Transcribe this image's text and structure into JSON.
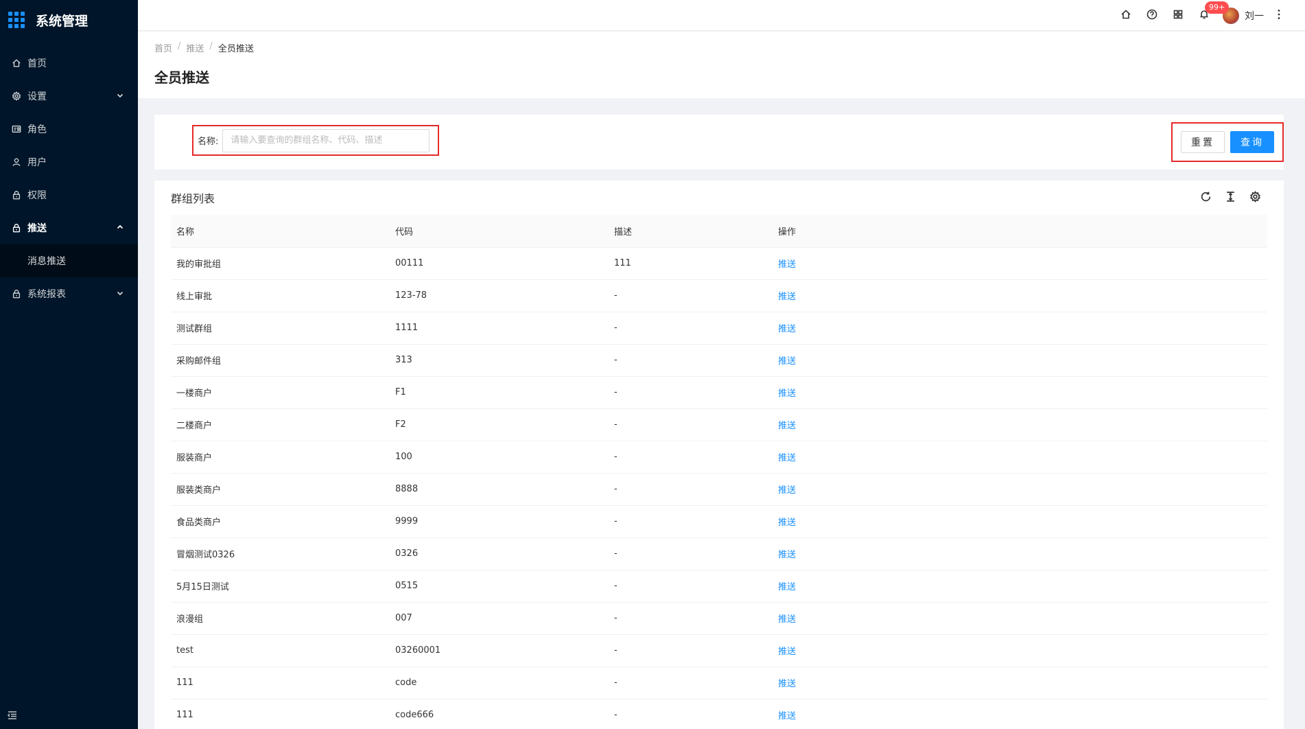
{
  "app": {
    "title": "系统管理"
  },
  "sidebar": {
    "items": [
      {
        "label": "首页",
        "icon": "home-icon"
      },
      {
        "label": "设置",
        "icon": "gear-icon",
        "expandable": true
      },
      {
        "label": "角色",
        "icon": "id-card-icon"
      },
      {
        "label": "用户",
        "icon": "user-icon"
      },
      {
        "label": "权限",
        "icon": "lock-icon"
      },
      {
        "label": "推送",
        "icon": "lock-icon",
        "expandable": true,
        "open": true
      },
      {
        "label": "系统报表",
        "icon": "lock-icon",
        "expandable": true
      }
    ],
    "submenu_push": [
      {
        "label": "消息推送"
      }
    ]
  },
  "header": {
    "notification_count": "99+",
    "username": "刘一"
  },
  "breadcrumb": {
    "home": "首页",
    "parent": "推送",
    "current": "全员推送"
  },
  "page": {
    "title": "全员推送"
  },
  "search": {
    "label": "名称:",
    "placeholder": "请输入要查询的群组名称、代码、描述",
    "value": "",
    "reset_label": "重置",
    "query_label": "查询"
  },
  "table": {
    "title": "群组列表",
    "columns": [
      "名称",
      "代码",
      "描述",
      "操作"
    ],
    "action_label": "推送",
    "rows": [
      {
        "name": "我的审批组",
        "code": "00111",
        "desc": "111"
      },
      {
        "name": "线上审批",
        "code": "123-78",
        "desc": "-"
      },
      {
        "name": "测试群组",
        "code": "1111",
        "desc": "-"
      },
      {
        "name": "采购邮件组",
        "code": "313",
        "desc": "-"
      },
      {
        "name": "一楼商户",
        "code": "F1",
        "desc": "-"
      },
      {
        "name": "二楼商户",
        "code": "F2",
        "desc": "-"
      },
      {
        "name": "服装商户",
        "code": "100",
        "desc": "-"
      },
      {
        "name": "服装类商户",
        "code": "8888",
        "desc": "-"
      },
      {
        "name": "食品类商户",
        "code": "9999",
        "desc": "-"
      },
      {
        "name": "冒烟测试0326",
        "code": "0326",
        "desc": "-"
      },
      {
        "name": "5月15日测试",
        "code": "0515",
        "desc": "-"
      },
      {
        "name": "浪漫组",
        "code": "007",
        "desc": "-"
      },
      {
        "name": "test",
        "code": "03260001",
        "desc": "-"
      },
      {
        "name": "111",
        "code": "code",
        "desc": "-"
      },
      {
        "name": "111",
        "code": "code666",
        "desc": "-"
      }
    ]
  },
  "colors": {
    "sidebar_bg": "#001529",
    "primary": "#1890ff",
    "highlight_border": "#e52929",
    "badge": "#ff4d4f"
  }
}
